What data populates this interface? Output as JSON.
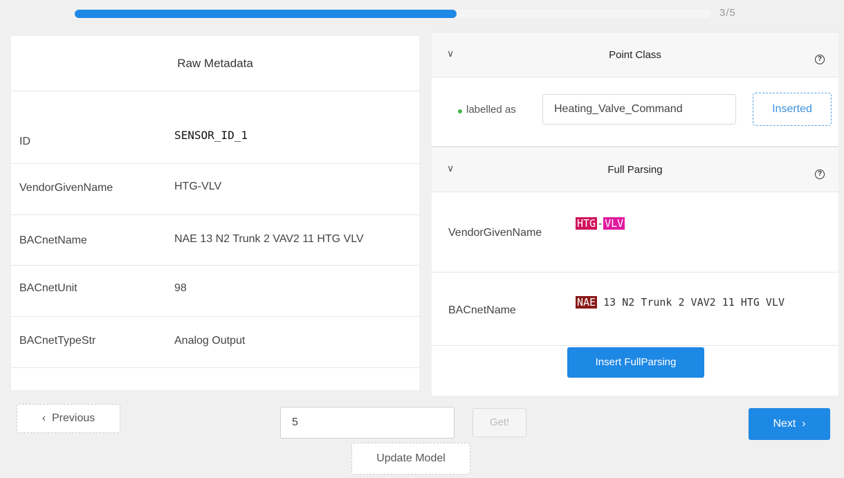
{
  "progress": {
    "text": "3/5",
    "fraction": 0.6
  },
  "raw_metadata": {
    "title": "Raw Metadata",
    "rows": [
      {
        "key": "ID",
        "value": "SENSOR_ID_1"
      },
      {
        "key": "VendorGivenName",
        "value": "HTG-VLV"
      },
      {
        "key": "BACnetName",
        "value": "NAE 13 N2 Trunk 2 VAV2 11 HTG VLV"
      },
      {
        "key": "BACnetUnit",
        "value": "98"
      },
      {
        "key": "BACnetTypeStr",
        "value": "Analog Output"
      }
    ]
  },
  "point_class": {
    "title": "Point Class",
    "labelled_as": "labelled as",
    "value": "Heating_Valve_Command",
    "inserted_label": "Inserted"
  },
  "full_parsing": {
    "title": "Full Parsing",
    "rows": [
      {
        "key": "VendorGivenName",
        "tokens": [
          "HTG",
          "-",
          "VLV"
        ]
      },
      {
        "key": "BACnetName",
        "tag": "NAE",
        "rest": " 13 N2 Trunk 2 VAV2 11 HTG VLV"
      }
    ],
    "insert_label": "Insert FullParsing"
  },
  "controls": {
    "previous_label": "Previous",
    "page_value": "5",
    "get_label": "Get!",
    "next_label": "Next",
    "update_label": "Update Model"
  },
  "icons": {
    "chevron": "chevron-down-icon",
    "help": "question-circle-icon",
    "prev": "chevron-left-icon",
    "next": "chevron-right-icon"
  },
  "colors": {
    "accent": "#1e88e5",
    "tag_red": "#d1125a",
    "tag_pink": "#e0199f",
    "tag_dark_red": "#8a1a1a"
  }
}
